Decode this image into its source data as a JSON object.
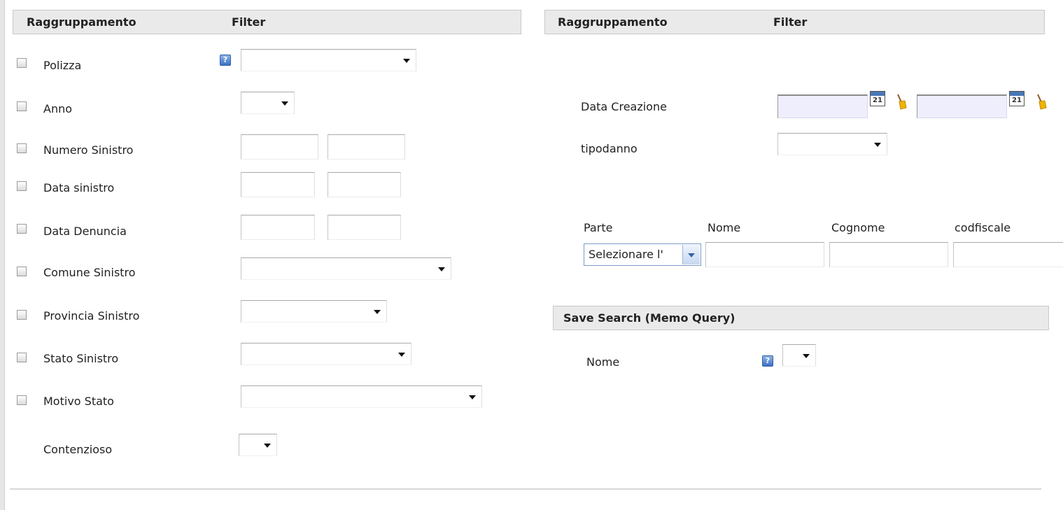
{
  "left_panel": {
    "header": {
      "grouping": "Raggruppamento",
      "filter": "Filter"
    },
    "rows": [
      {
        "label": "Polizza"
      },
      {
        "label": "Anno"
      },
      {
        "label": "Numero Sinistro"
      },
      {
        "label": "Data sinistro"
      },
      {
        "label": "Data Denuncia"
      },
      {
        "label": "Comune Sinistro"
      },
      {
        "label": "Provincia Sinistro"
      },
      {
        "label": "Stato Sinistro"
      },
      {
        "label": "Motivo Stato"
      },
      {
        "label": "Contenzioso"
      }
    ]
  },
  "right_panel": {
    "header": {
      "grouping": "Raggruppamento",
      "filter": "Filter"
    },
    "data_creazione": {
      "label": "Data Creazione",
      "calendar_day": "21"
    },
    "tipodanno": {
      "label": "tipodanno"
    },
    "parte_table": {
      "columns": [
        "Parte",
        "Nome",
        "Cognome",
        "codfiscale"
      ],
      "parte_selected": "Selezionare l'"
    },
    "save_search": {
      "title": "Save Search (Memo Query)",
      "nome_label": "Nome"
    }
  },
  "help_glyph": "?",
  "icons": [
    "help-icon",
    "calendar-icon",
    "broom-clear-icon",
    "checkbox",
    "dropdown-arrow-icon"
  ],
  "colors": {
    "header_bg": "#eaeaea",
    "date_input_bg": "#eeeefd",
    "help_icon": "#3c72c4",
    "select_accent": "#7a9cc8"
  }
}
